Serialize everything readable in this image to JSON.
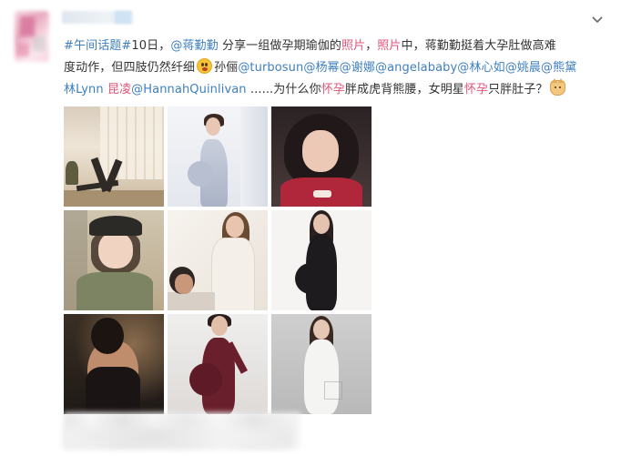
{
  "post": {
    "chevron_icon": "chevron-down-icon",
    "text": {
      "hashtag": "#午间话题#",
      "date": "10日，",
      "mention_jiang": "@蒋勤勤",
      "t1": " 分享一组做孕期瑜伽的",
      "photo1": "照片",
      "comma": "，",
      "photo2": "照片",
      "t2": "中，蒋勤勤挺着大孕肚做高难",
      "t3": "度动作，但四肢仍然纤细",
      "emoji1": "surprised-face-emoji",
      "t4": "孙俪",
      "mention_turbosun": "@turbosun",
      "mention_yangmi": "@杨幂",
      "mention_xiena": "@谢娜",
      "mention_angelababy": "@angelababy",
      "mention_linxinru": "@林心如",
      "mention_yaochen": "@姚晨",
      "mention_xiong": "@熊黛",
      "t5a": "林Lynn",
      "t5b": " 昆凌",
      "mention_hannah": "@HannahQuinlivan",
      "t6": " ......为什么你",
      "hl1": "怀孕",
      "t7": "胖成虎背熊腰，女明星",
      "hl2": "怀孕",
      "t8": "只胖肚子？",
      "emoji2": "cat-face-emoji"
    },
    "images": [
      {
        "name": "photo-yoga"
      },
      {
        "name": "photo-white-dress"
      },
      {
        "name": "photo-selfie-red"
      },
      {
        "name": "photo-military-cap"
      },
      {
        "name": "photo-couple"
      },
      {
        "name": "photo-black-dress"
      },
      {
        "name": "photo-dark-lingerie"
      },
      {
        "name": "photo-burgundy-dress"
      },
      {
        "name": "photo-white-gown"
      }
    ],
    "colors": {
      "link": "#3f7fbf",
      "highlight": "#e3557a",
      "text": "#333333"
    }
  }
}
